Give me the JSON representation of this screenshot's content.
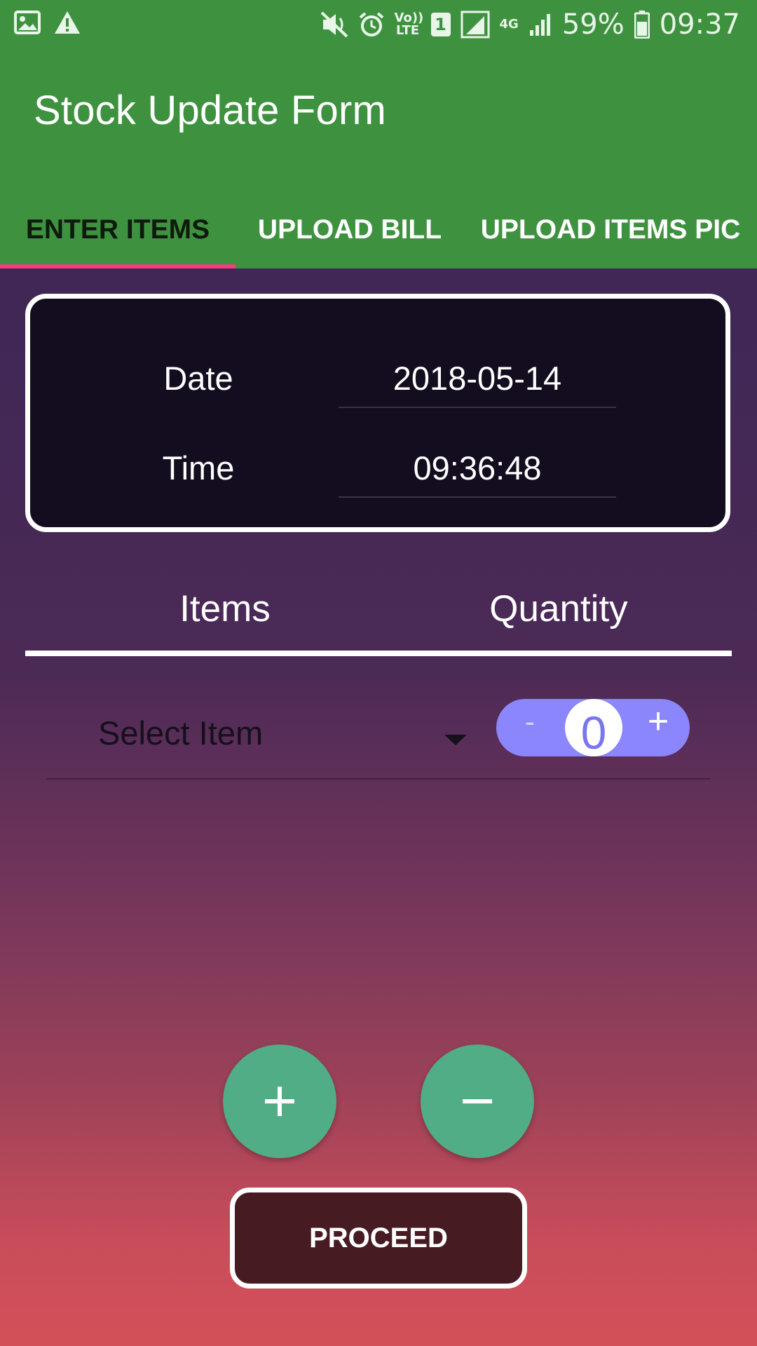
{
  "status_bar": {
    "battery": "59%",
    "time": "09:37",
    "icons": [
      "image-icon",
      "warning-icon",
      "mute-icon",
      "alarm-icon",
      "volte-icon",
      "sim-icon",
      "signal-icon",
      "4g-icon",
      "signal-bars-icon",
      "battery-icon"
    ],
    "volte_label": "Vo)) LTE",
    "sim_label": "1",
    "network_label": "4G"
  },
  "app": {
    "title": "Stock Update Form",
    "header_color": "#3e923f",
    "accent_color": "#ef3f7c"
  },
  "tabs": [
    {
      "label": "ENTER ITEMS",
      "active": true
    },
    {
      "label": "UPLOAD BILL",
      "active": false
    },
    {
      "label": "UPLOAD ITEMS PIC",
      "active": false
    }
  ],
  "datetime": {
    "date_label": "Date",
    "date_value": "2018-05-14",
    "time_label": "Time",
    "time_value": "09:36:48"
  },
  "list_header": {
    "items": "Items",
    "quantity": "Quantity"
  },
  "item_row": {
    "select_placeholder": "Select Item",
    "stepper_minus": "-",
    "stepper_plus": "+",
    "quantity": "0"
  },
  "actions": {
    "add_icon": "plus-icon",
    "remove_icon": "minus-icon",
    "fab_color": "#50ad85",
    "proceed_label": "PROCEED"
  }
}
